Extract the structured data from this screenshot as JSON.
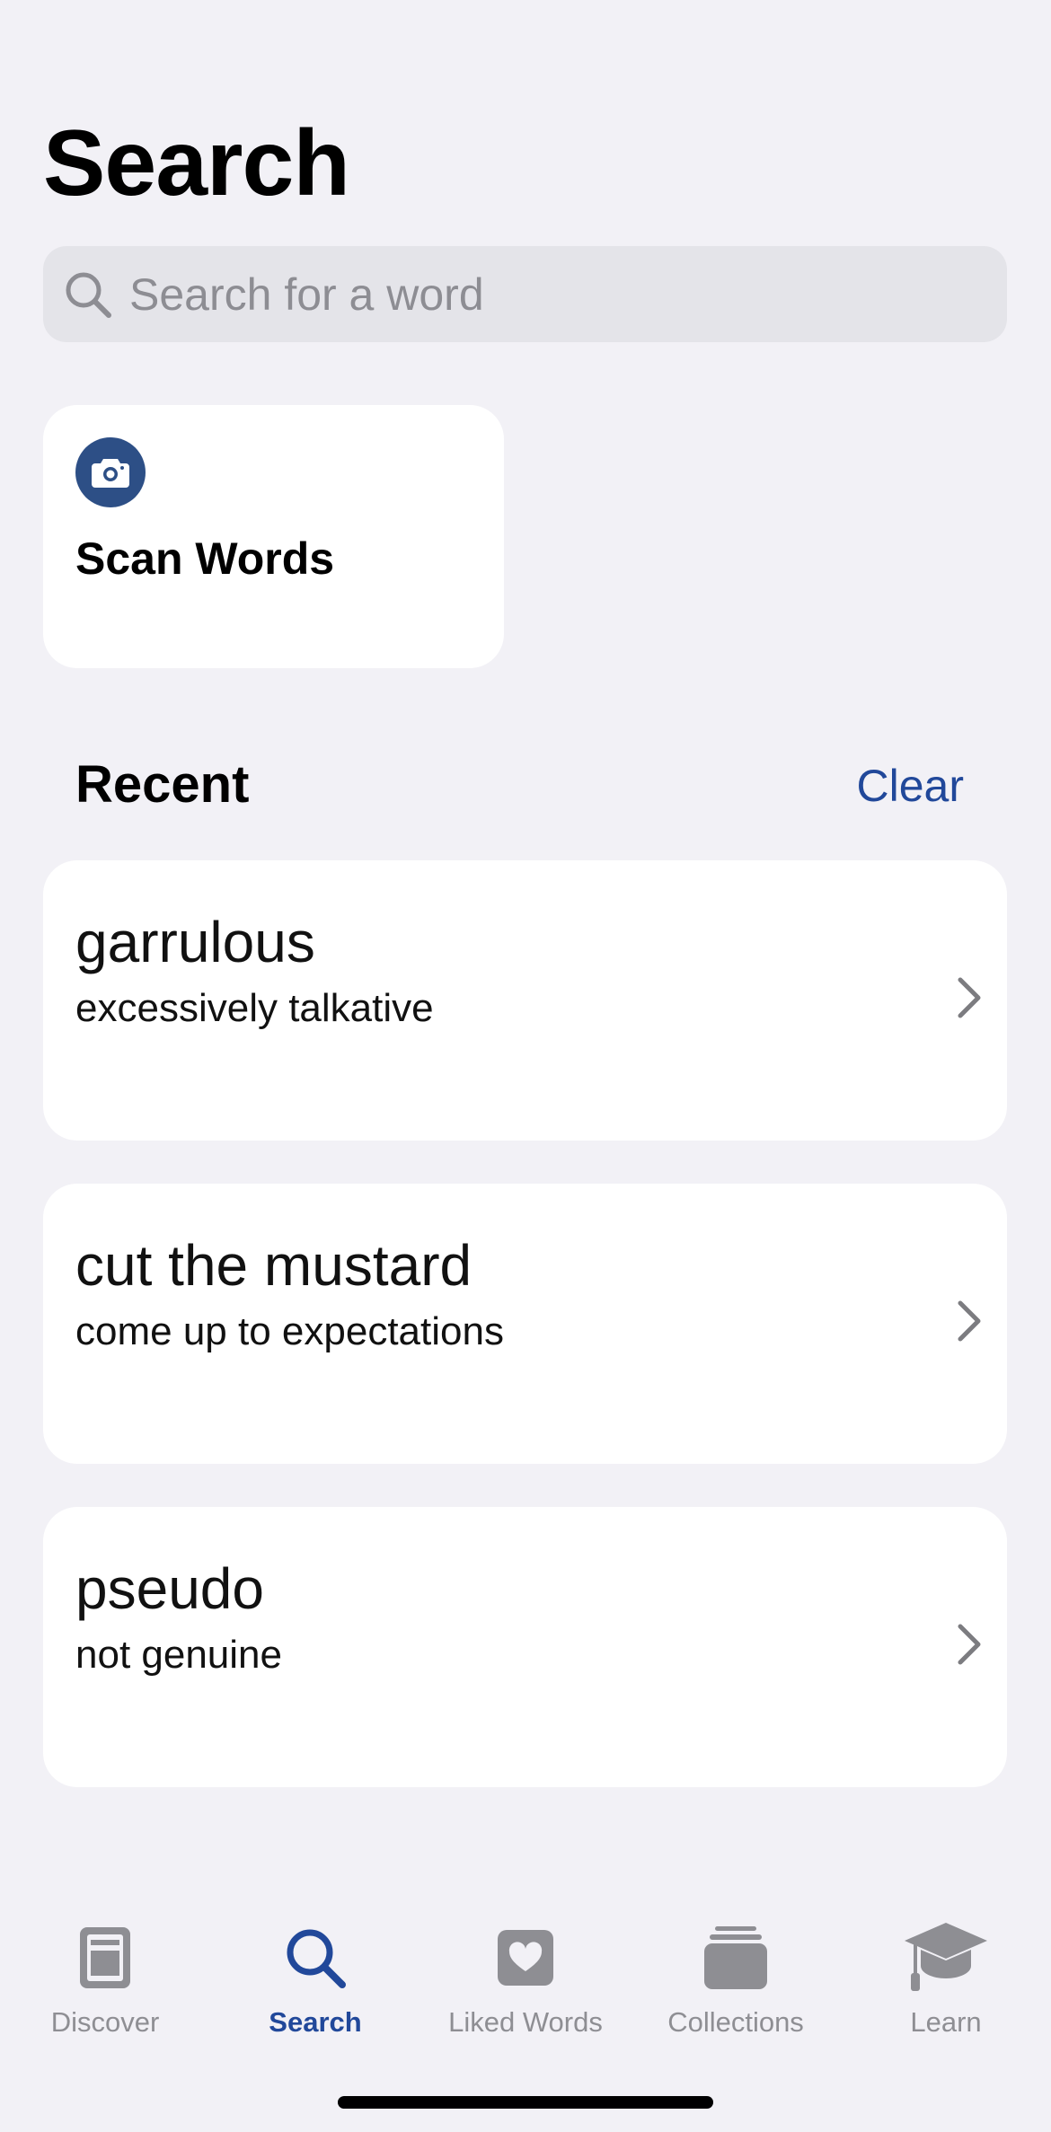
{
  "header": {
    "title": "Search"
  },
  "search": {
    "placeholder": "Search for a word",
    "value": ""
  },
  "scan": {
    "label": "Scan Words",
    "icon": "camera-icon"
  },
  "recent": {
    "title": "Recent",
    "clear_label": "Clear",
    "items": [
      {
        "word": "garrulous",
        "definition": "excessively talkative"
      },
      {
        "word": "cut the mustard",
        "definition": "come up to expectations"
      },
      {
        "word": "pseudo",
        "definition": "not genuine"
      }
    ]
  },
  "tabs": [
    {
      "label": "Discover",
      "icon": "newspaper-icon",
      "active": false
    },
    {
      "label": "Search",
      "icon": "search-icon",
      "active": true
    },
    {
      "label": "Liked Words",
      "icon": "heart-icon",
      "active": false
    },
    {
      "label": "Collections",
      "icon": "stack-icon",
      "active": false
    },
    {
      "label": "Learn",
      "icon": "graduation-cap-icon",
      "active": false
    }
  ],
  "colors": {
    "accent": "#21489a",
    "background": "#f2f1f6",
    "card": "#ffffff",
    "inactive_tab": "#8e8e93",
    "camera_badge": "#2d4f86"
  }
}
